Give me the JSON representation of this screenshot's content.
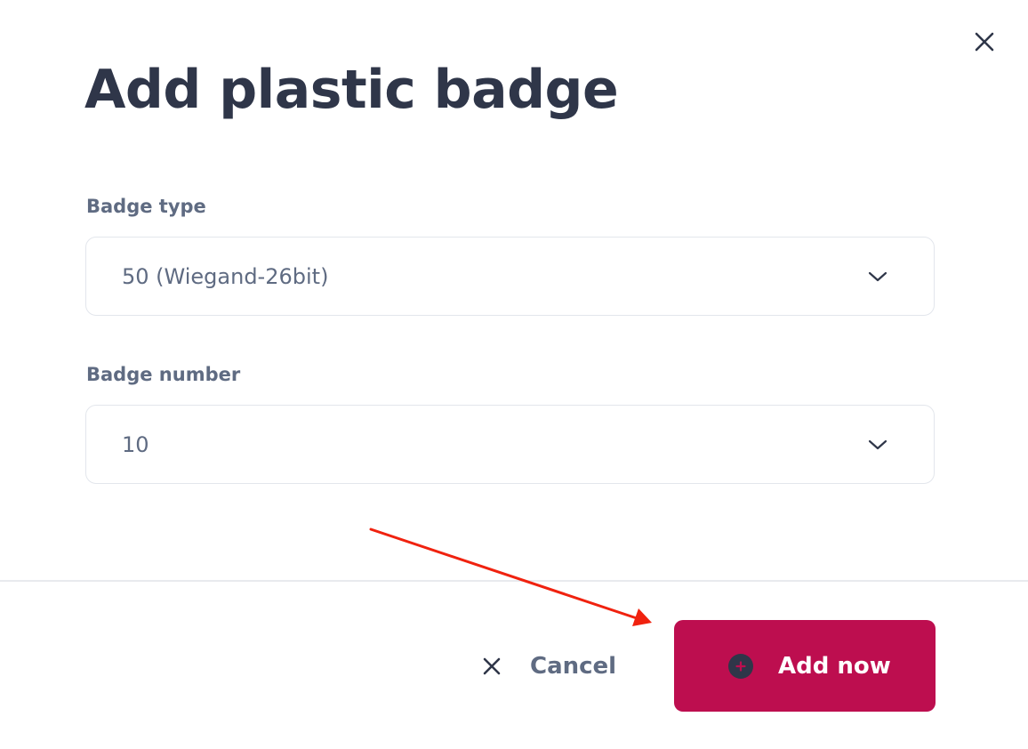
{
  "dialog": {
    "title": "Add plastic badge",
    "close_icon": "close-icon"
  },
  "fields": {
    "badge_type": {
      "label": "Badge type",
      "value": "50 (Wiegand-26bit)",
      "icon": "chevron-down-icon"
    },
    "badge_number": {
      "label": "Badge number",
      "value": "10",
      "icon": "chevron-down-icon"
    }
  },
  "footer": {
    "cancel_label": "Cancel",
    "cancel_icon": "close-icon",
    "add_label": "Add now",
    "add_icon": "plus-circle-icon"
  },
  "colors": {
    "primary_button": "#bd0e4f",
    "text_dark": "#2f3649",
    "text_muted": "#5f6b82",
    "annotation_arrow": "#f0220f"
  }
}
